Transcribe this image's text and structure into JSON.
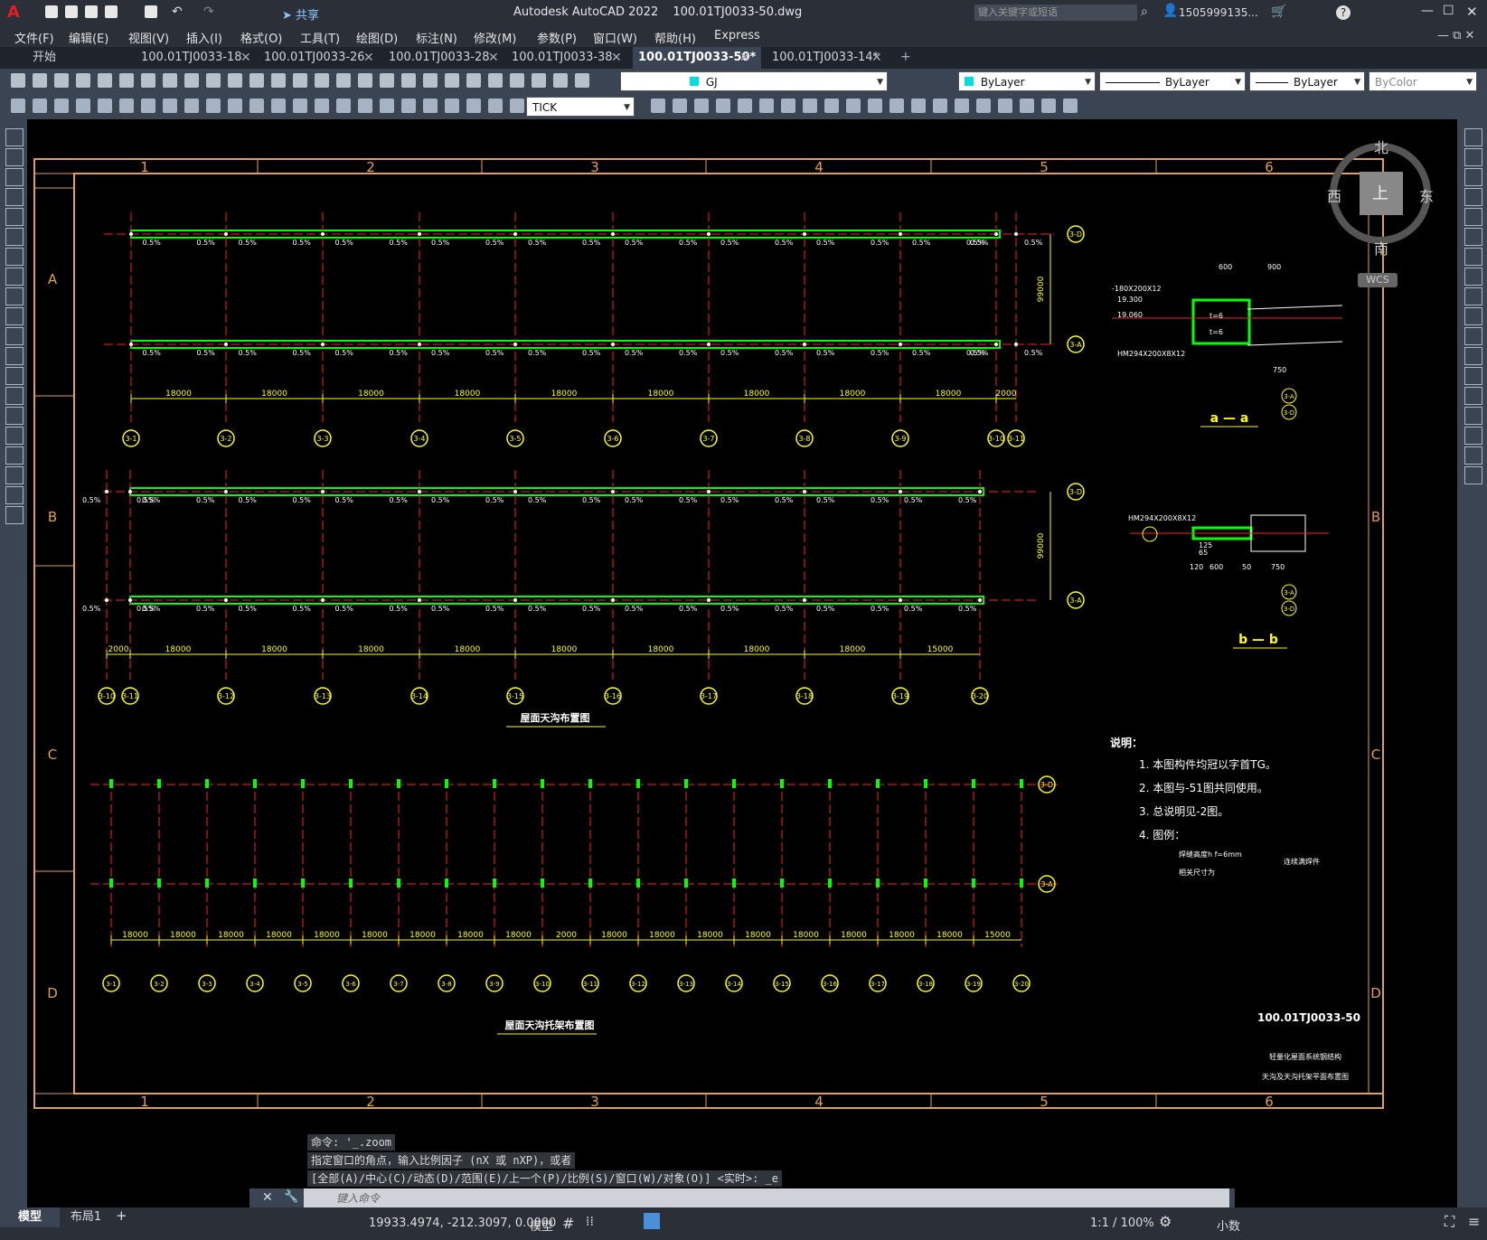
{
  "app": {
    "title": "Autodesk AutoCAD 2022",
    "file": "100.01TJ0033-50.dwg",
    "search_placeholder": "键入关键字或短语",
    "user": "1505999135...",
    "share": "共享"
  },
  "menu": [
    "文件(F)",
    "编辑(E)",
    "视图(V)",
    "插入(I)",
    "格式(O)",
    "工具(T)",
    "绘图(D)",
    "标注(N)",
    "修改(M)",
    "参数(P)",
    "窗口(W)",
    "帮助(H)",
    "Express"
  ],
  "tabs": [
    "开始",
    "100.01TJ0033-18",
    "100.01TJ0033-26",
    "100.01TJ0033-28",
    "100.01TJ0033-38",
    "100.01TJ0033-50*",
    "100.01TJ0033-14*"
  ],
  "toolbar": {
    "layer": "GJ",
    "color": "ByLayer",
    "linetype": "ByLayer",
    "lineweight": "ByLayer",
    "plotstyle": "ByColor",
    "dimstyle": "TICK"
  },
  "viewcube": {
    "north": "北",
    "south": "南",
    "east": "东",
    "west": "西",
    "top": "上",
    "wcs": "WCS"
  },
  "drawing": {
    "col_numbers": [
      "1",
      "2",
      "3",
      "4",
      "5",
      "6"
    ],
    "row_letters": [
      "A",
      "B",
      "C",
      "D"
    ],
    "title1": "屋面天沟布置图",
    "title2": "屋面天沟托架布置图",
    "span18": "18000",
    "span15": "15000",
    "span2": "2000",
    "span99": "99000",
    "top_axes": [
      "3-1",
      "3-2",
      "3-3",
      "3-4",
      "3-5",
      "3-6",
      "3-7",
      "3-8",
      "3-9",
      "3-10",
      "3-11"
    ],
    "mid_axes": [
      "3-10",
      "3-11",
      "3-12",
      "3-13",
      "3-14",
      "3-15",
      "3-16",
      "3-17",
      "3-18",
      "3-19",
      "3-20"
    ],
    "bottom_axes": [
      "3-1",
      "3-2",
      "3-3",
      "3-4",
      "3-5",
      "3-6",
      "3-7",
      "3-8",
      "3-9",
      "3-10",
      "3-11",
      "3-12",
      "3-13",
      "3-14",
      "3-15",
      "3-16",
      "3-17",
      "3-18",
      "3-19",
      "3-20"
    ],
    "axis_D": "3-D",
    "axis_A": "3-A",
    "section_aa": "a — a",
    "section_bb": "b — b",
    "detail_labels": [
      "-180X200X12",
      "19.300",
      "19.060",
      "HM294X200X8X12",
      "t=6",
      "t=6",
      "600",
      "900",
      "750"
    ],
    "detail_labels_b": [
      "HM294X200X8X12",
      "120",
      "600",
      "50",
      "750",
      "65",
      "125"
    ],
    "notes_title": "说明：",
    "notes": [
      "1. 本图构件均冠以字首TG。",
      "2. 本图与-51图共同使用。",
      "3. 总说明见-2图。",
      "4. 图例："
    ],
    "legend": [
      "焊缝高度h f=6mm",
      "相关尺寸为",
      "连续满焊件"
    ],
    "drawing_no": "100.01TJ0033-50",
    "sheet_line1": "轻量化屋面系统钢结构",
    "sheet_line2": "天沟及天沟托架平面布置图"
  },
  "command": {
    "history": [
      "命令: '_.zoom",
      "指定窗口的角点，输入比例因子 (nX 或 nXP)，或者",
      "[全部(A)/中心(C)/动态(D)/范围(E)/上一个(P)/比例(S)/窗口(W)/对象(O)] <实时>: _e"
    ],
    "placeholder": "键入命令"
  },
  "status": {
    "model_tab": "模型",
    "layout_tab": "布局1",
    "coords": "19933.4974, -212.3097, 0.0000",
    "mode": "模型",
    "scale": "1:1 / 100%",
    "units": "小数"
  },
  "colors": {
    "bg": "#000000",
    "frame": "#e0a050",
    "gutter": "#00ff00",
    "axis": "#ff2020",
    "text": "#ffff00",
    "white": "#ffffff"
  }
}
